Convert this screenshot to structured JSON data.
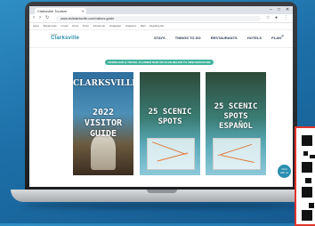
{
  "browser": {
    "tab_title": "Clarksville Tourism",
    "url": "www.visitclarksville.com/visitors-guide"
  },
  "bookmarks": [
    "Apps",
    "Bookmarks",
    "Gmail",
    "Docs",
    "Drive",
    "Facebook",
    "Instagram",
    "Analytics",
    "Mail",
    "Reading list"
  ],
  "site": {
    "logo_top": "VISIT",
    "logo": "Clarksville",
    "nav": [
      "STAYS",
      "THINGS TO DO",
      "RESTAURANTS",
      "HOTELS",
      "PLAN"
    ],
    "banner": "DOWNLOAD & TRAVEL PLANNER NOW OR SCAN BELOW TO VIEW BROCHURE"
  },
  "cards": [
    {
      "title": "CLARKSVILLE",
      "subtitle": "2022 VISITOR\nGUIDE"
    },
    {
      "title": "25 SCENIC\nSPOTS"
    },
    {
      "title": "25 SCENIC\nSPOTS\nESPAÑOL"
    }
  ],
  "chat_badge": "Chat\nwith us",
  "colors": {
    "accent": "#2a8fb0",
    "banner": "#3fb39b",
    "qr_border": "#e0342d"
  }
}
